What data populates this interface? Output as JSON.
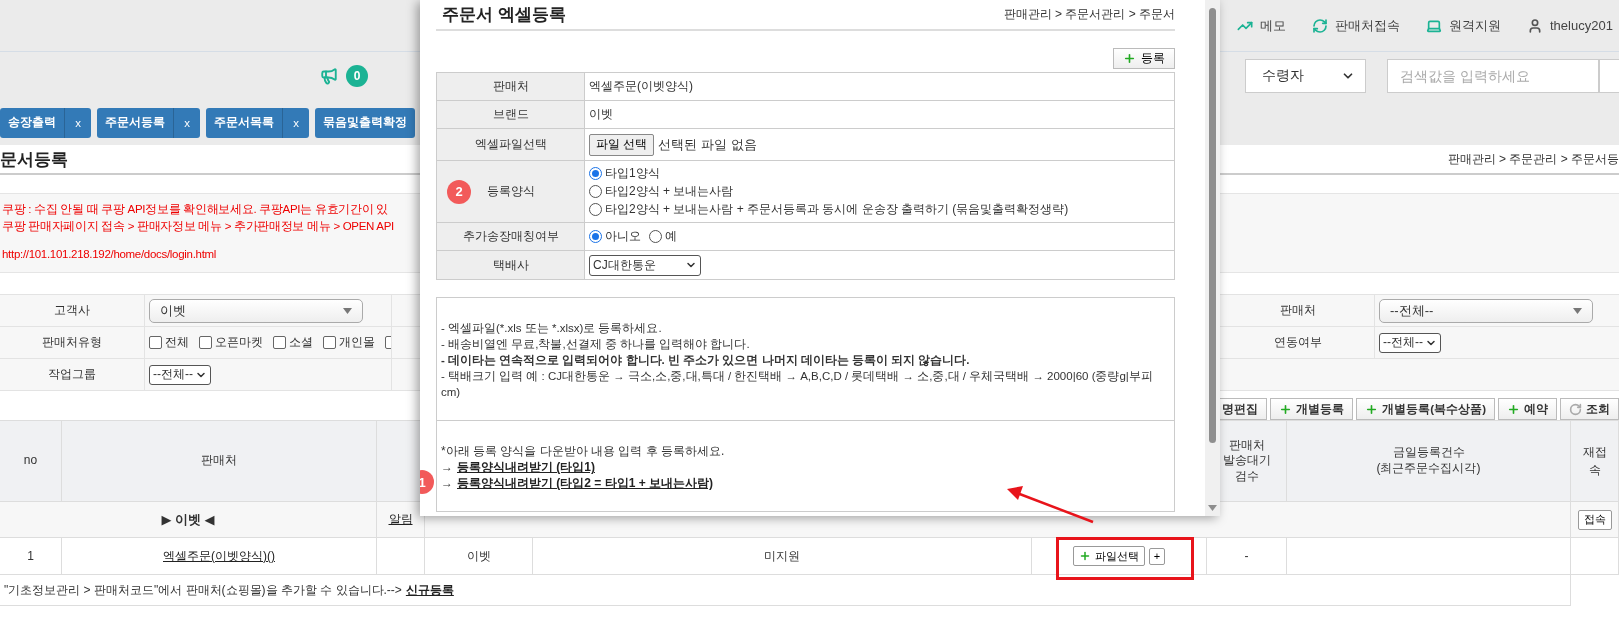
{
  "top_links": [
    {
      "label": "메모"
    },
    {
      "label": "판매처접속"
    },
    {
      "label": "원격지원"
    },
    {
      "label": "thelucy201"
    }
  ],
  "notification_count": "0",
  "search": {
    "field": "수령자",
    "placeholder": "검색값을 입력하세요"
  },
  "tabs": [
    {
      "label": "송장출력",
      "close": "x",
      "selected": false
    },
    {
      "label": "주문서등록",
      "close": "x",
      "selected": false
    },
    {
      "label": "주문서목록",
      "close": "x",
      "selected": false
    },
    {
      "label": "묶음및출력확정",
      "selected": false
    }
  ],
  "page": {
    "title": "문서등록",
    "breadcrumb": "판매관리 > 주문관리 > 주문서등"
  },
  "notices": [
    "쿠팡 : 수집 안될 때 쿠팡 API정보를 확인해보세요. 쿠팡API는 유효기간이 있",
    "쿠팡 판매자페이지 접속 > 판매자정보 메뉴 > 추가판매정보 메뉴 > OPEN API",
    "http://101.101.218.192/home/docs/login.html"
  ],
  "filters": {
    "left": [
      {
        "kind": "select",
        "label": "고객사",
        "value": "이벳"
      },
      {
        "kind": "checkboxes",
        "label": "판매처유형",
        "options": [
          {
            "label": "전체",
            "checked": false
          },
          {
            "label": "오픈마켓",
            "checked": false
          },
          {
            "label": "소셜",
            "checked": false
          },
          {
            "label": "개인몰",
            "checked": false
          },
          {
            "checked": false
          }
        ]
      },
      {
        "kind": "dropdown",
        "label": "작업그룹",
        "value": "--전체--"
      }
    ],
    "right": [
      {
        "kind": "select",
        "label": "판매처",
        "value": "--전체--"
      },
      {
        "kind": "dropdown",
        "label": "연동여부",
        "value": "--전체--"
      }
    ]
  },
  "toolbar": [
    {
      "kind": "plain",
      "label": "명편집"
    },
    {
      "kind": "add",
      "label": "개별등록"
    },
    {
      "kind": "add",
      "label": "개별등록(복수상품)"
    },
    {
      "kind": "add",
      "label": "예약"
    },
    {
      "kind": "refresh",
      "label": "조회"
    }
  ],
  "table": {
    "columns": [
      {
        "label": "no"
      },
      {
        "label": "판매처"
      },
      {
        "label": "판매처 발송대기 검수"
      },
      {
        "label": "금일등록건수",
        "sub": "(최근주문수집시각)"
      },
      {
        "label": "재접속"
      }
    ],
    "group": {
      "label": "▶ 이벳 ◀",
      "alert": "알림",
      "connect": "접속"
    },
    "rows": [
      {
        "no": "1",
        "seller": "엑셀주문(이벳양식)()",
        "brand": "이벳",
        "api": "미지원",
        "upload": "파일선택",
        "more": "+",
        "pending": "-"
      }
    ]
  },
  "footer": {
    "text": "\"기초정보관리 > 판매처코드\"에서 판매처(쇼핑몰)을 추가할 수 있습니다.-->",
    "link": "신규등록"
  },
  "dialog": {
    "title": "주문서 엑셀등록",
    "breadcrumb": "판매관리 > 주문서관리 > 주문서",
    "submit": "등록",
    "fields": [
      {
        "kind": "text",
        "label": "판매처",
        "value": "엑셀주문(이벳양식)"
      },
      {
        "kind": "text",
        "label": "브랜드",
        "value": "이벳"
      },
      {
        "kind": "file",
        "label": "엑셀파일선택",
        "button": "파일 선택",
        "value": "선택된 파일 없음"
      },
      {
        "kind": "radios",
        "label": "등록양식",
        "step": "2",
        "options": [
          {
            "label": "타입1양식",
            "selected": true
          },
          {
            "label": "타입2양식 + 보내는사람",
            "selected": false
          },
          {
            "label": "타입2양식 + 보내는사람 + 주문서등록과 동시에 운송장 출력하기 (묶음및출력확정생략)",
            "selected": false
          }
        ]
      },
      {
        "kind": "choice",
        "label": "추가송장매칭여부",
        "options": [
          {
            "label": "아니오",
            "selected": true
          },
          {
            "label": "예",
            "selected": false
          }
        ]
      },
      {
        "kind": "select",
        "label": "택배사",
        "value": "CJ대한통운"
      }
    ],
    "notes": [
      {
        "text": "- 엑셀파일(*.xls 또는 *.xlsx)로 등록하세요.",
        "bold": false
      },
      {
        "text": "- 배송비열엔 무료,착불,선결제 중 하나를 입력해야 합니다.",
        "bold": false
      },
      {
        "text": "- 데이타는 연속적으로 입력되어야 합니다. 빈 주소가 있으면 나머지 데이타는 등록이 되지 않습니다.",
        "bold": true
      },
      {
        "text": "- 택배크기 입력 예 : CJ대한통운 → 극소,소,중,대,특대 / 한진택배 → A,B,C,D / 롯데택배 → 소,중,대 / 우체국택배 → 2000|60 (중량g|부피cm)",
        "bold": false
      }
    ],
    "download": {
      "intro": "*아래 등록 양식을 다운받아 내용 입력 후 등록하세요.",
      "step": "1",
      "links": [
        {
          "arrow": "→",
          "label": "등록양식내려받기 (타입1)"
        },
        {
          "arrow": "→",
          "label": "등록양식내려받기 (타입2 = 타입1 + 보내는사람)"
        }
      ]
    }
  }
}
